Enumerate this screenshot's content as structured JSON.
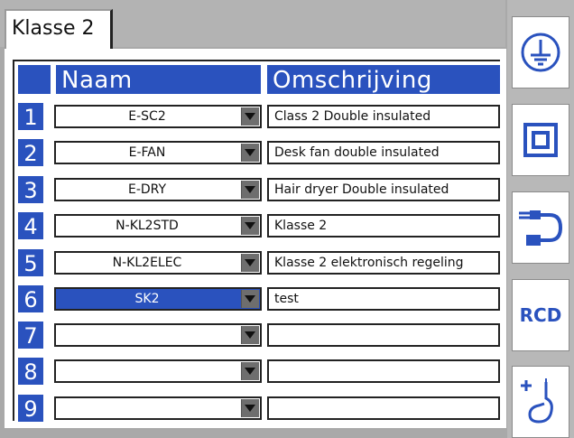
{
  "tab": {
    "label": "Klasse 2"
  },
  "table": {
    "headers": {
      "naam": "Naam",
      "omschrijving": "Omschrijving"
    },
    "rows": [
      {
        "num": "1",
        "naam": "E-SC2",
        "omschrijving": "Class 2 Double insulated"
      },
      {
        "num": "2",
        "naam": "E-FAN",
        "omschrijving": "Desk fan double insulated"
      },
      {
        "num": "3",
        "naam": "E-DRY",
        "omschrijving": "Hair dryer Double insulated"
      },
      {
        "num": "4",
        "naam": "N-KL2STD",
        "omschrijving": "Klasse 2"
      },
      {
        "num": "5",
        "naam": "N-KL2ELEC",
        "omschrijving": "Klasse 2 elektronisch regeling"
      },
      {
        "num": "6",
        "naam": "SK2",
        "omschrijving": "test"
      },
      {
        "num": "7",
        "naam": "",
        "omschrijving": ""
      },
      {
        "num": "8",
        "naam": "",
        "omschrijving": ""
      },
      {
        "num": "9",
        "naam": "",
        "omschrijving": ""
      }
    ],
    "selected_row": "6"
  },
  "sidebar": {
    "buttons": [
      {
        "icon": "earth-ground-icon"
      },
      {
        "icon": "double-insulated-icon"
      },
      {
        "icon": "extension-cord-icon"
      },
      {
        "icon": "rcd-icon",
        "label": "RCD"
      },
      {
        "icon": "add-probe-icon"
      }
    ]
  },
  "colors": {
    "accent": "#2a52be",
    "background": "#a9a9a9",
    "panel": "#ffffff"
  }
}
